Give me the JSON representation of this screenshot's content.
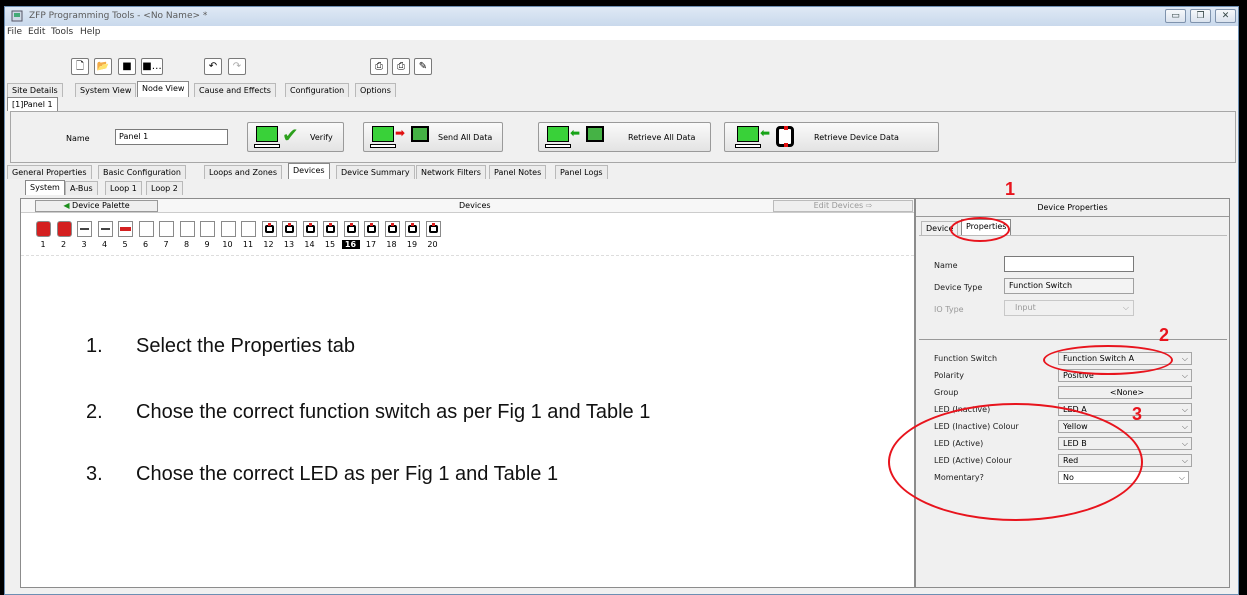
{
  "window": {
    "title": "ZFP Programming Tools - <No Name> *",
    "controls": [
      "minimize",
      "maximize",
      "close"
    ]
  },
  "menu": [
    "File",
    "Edit",
    "Tools",
    "Help"
  ],
  "toolbar_icons": [
    "new-file-icon",
    "open-folder-icon",
    "save-icon",
    "save-as-icon",
    "undo-icon",
    "redo-icon",
    "print-icon",
    "print-preview-icon",
    "print-setup-icon"
  ],
  "top_tabs": [
    "Site Details",
    "System View",
    "Node View",
    "Cause and Effects",
    "Configuration",
    "Options"
  ],
  "top_tabs_active": "Node View",
  "panel_tab": "[1]Panel 1",
  "panel": {
    "name_label": "Name",
    "name_value": "Panel 1",
    "verify": "Verify",
    "send_all": "Send All Data",
    "retrieve_all": "Retrieve All Data",
    "retrieve_device": "Retrieve Device Data"
  },
  "sub_tabs": [
    "General Properties",
    "Basic Configuration",
    "Loops and Zones",
    "Devices",
    "Device Summary",
    "Network Filters",
    "Panel Notes",
    "Panel Logs"
  ],
  "sub_tabs_active": "Devices",
  "loop_tabs": [
    "System",
    "A-Bus",
    "Loop 1",
    "Loop 2"
  ],
  "loop_tabs_active": "System",
  "devices_header": {
    "palette": "Device Palette",
    "title": "Devices",
    "edit": "Edit Devices"
  },
  "device_numbers": [
    "1",
    "2",
    "3",
    "4",
    "5",
    "6",
    "7",
    "8",
    "9",
    "10",
    "11",
    "12",
    "13",
    "14",
    "15",
    "16",
    "17",
    "18",
    "19",
    "20"
  ],
  "selected_device": "16",
  "instructions": [
    {
      "num": "1.",
      "text": "Select the Properties tab"
    },
    {
      "num": "2.",
      "text": "Chose the correct function switch as per Fig 1 and Table 1"
    },
    {
      "num": "3.",
      "text": "Chose the correct LED as per Fig 1 and Table 1"
    }
  ],
  "right": {
    "header": "Device Properties",
    "tabs": [
      "Device",
      "Properties"
    ],
    "active_tab": "Properties",
    "fields": {
      "name": {
        "label": "Name",
        "value": ""
      },
      "device_type": {
        "label": "Device Type",
        "value": "Function Switch"
      },
      "io_type": {
        "label": "IO Type",
        "value": "Input"
      }
    },
    "props": [
      {
        "label": "Function Switch",
        "value": "Function Switch A"
      },
      {
        "label": "Polarity",
        "value": "Positive"
      },
      {
        "label": "Group",
        "value": "<None>"
      },
      {
        "label": "LED (Inactive)",
        "value": "LED A"
      },
      {
        "label": "LED (Inactive) Colour",
        "value": "Yellow"
      },
      {
        "label": "LED (Active)",
        "value": "LED B"
      },
      {
        "label": "LED (Active) Colour",
        "value": "Red"
      },
      {
        "label": "Momentary?",
        "value": "No"
      }
    ]
  },
  "annotations": [
    "1",
    "2",
    "3"
  ],
  "colors": {
    "annotation": "#e8141d",
    "green": "#39d139"
  }
}
